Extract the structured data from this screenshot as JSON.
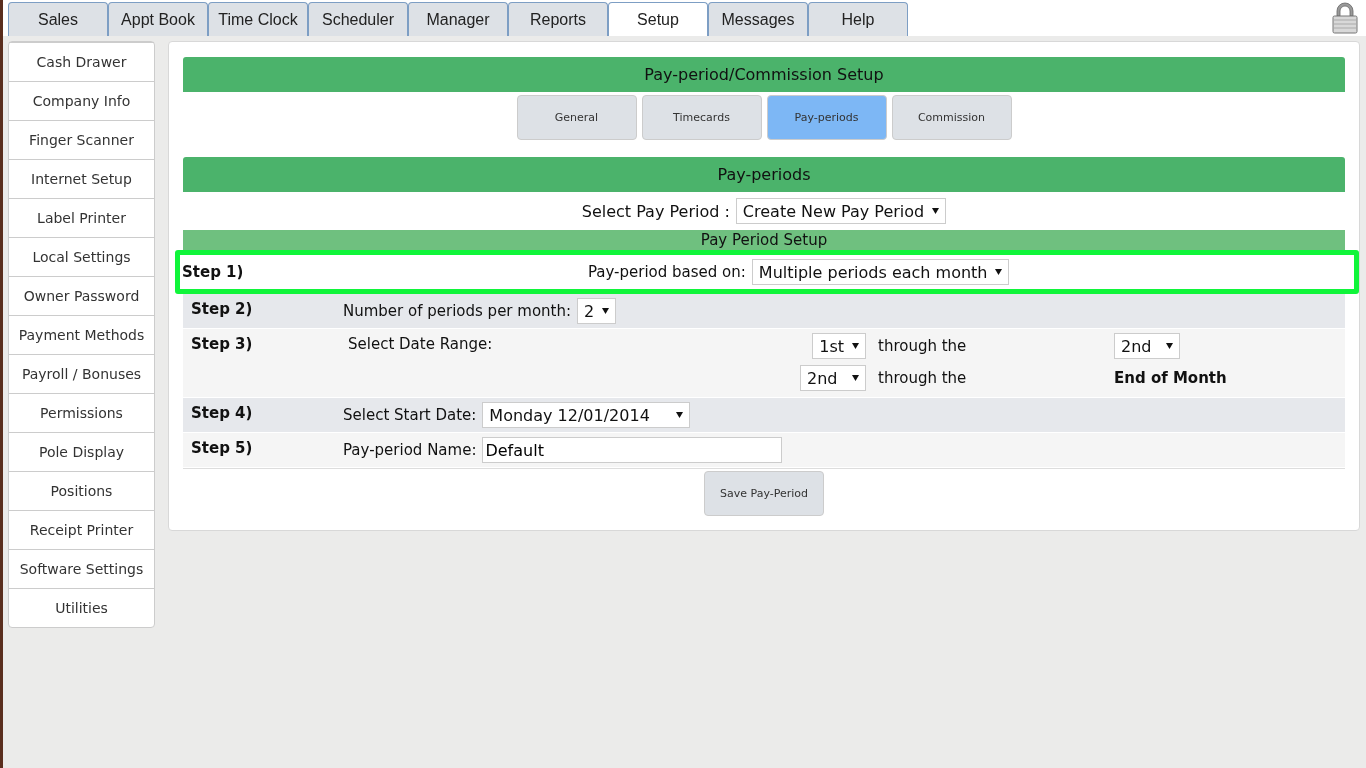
{
  "top_tabs": [
    {
      "label": "Sales",
      "selected": false
    },
    {
      "label": "Appt Book",
      "selected": false
    },
    {
      "label": "Time Clock",
      "selected": false
    },
    {
      "label": "Scheduler",
      "selected": false
    },
    {
      "label": "Manager",
      "selected": false
    },
    {
      "label": "Reports",
      "selected": false
    },
    {
      "label": "Setup",
      "selected": true
    },
    {
      "label": "Messages",
      "selected": false
    },
    {
      "label": "Help",
      "selected": false
    }
  ],
  "sidebar": {
    "items": [
      {
        "label": "Cash Drawer"
      },
      {
        "label": "Company Info"
      },
      {
        "label": "Finger Scanner"
      },
      {
        "label": "Internet Setup"
      },
      {
        "label": "Label Printer"
      },
      {
        "label": "Local Settings"
      },
      {
        "label": "Owner Password"
      },
      {
        "label": "Payment Methods"
      },
      {
        "label": "Payroll / Bonuses"
      },
      {
        "label": "Permissions"
      },
      {
        "label": "Pole Display"
      },
      {
        "label": "Positions"
      },
      {
        "label": "Receipt Printer"
      },
      {
        "label": "Software Settings"
      },
      {
        "label": "Utilities"
      }
    ]
  },
  "header": "Pay-period/Commission Setup",
  "sub_tabs": [
    {
      "label": "General",
      "selected": false
    },
    {
      "label": "Timecards",
      "selected": false
    },
    {
      "label": "Pay-periods",
      "selected": true
    },
    {
      "label": "Commission",
      "selected": false
    }
  ],
  "section_title": "Pay-periods",
  "select_pay_period": {
    "label": "Select Pay Period :",
    "value": "Create New Pay Period"
  },
  "setup_title": "Pay Period Setup",
  "steps": [
    {
      "step": "Step 1)",
      "highlighted": true,
      "kind": "select",
      "label": "Pay-period based on:",
      "value": "Multiple periods each month"
    },
    {
      "step": "Step 2)",
      "highlighted": false,
      "kind": "select",
      "label": "Number of periods per month:",
      "value": "2"
    },
    {
      "step": "Step 3)",
      "highlighted": false,
      "kind": "ranges",
      "label": "Select Date Range:",
      "ranges": [
        {
          "from": "1st",
          "through": "through the",
          "to": "2nd",
          "kind": "select"
        },
        {
          "from": "2nd",
          "through": "through the",
          "to": "End of Month",
          "kind": "text"
        }
      ]
    },
    {
      "step": "Step 4)",
      "highlighted": false,
      "kind": "select",
      "label": "Select Start Date:",
      "value": "Monday 12/01/2014"
    },
    {
      "step": "Step 5)",
      "highlighted": false,
      "kind": "input",
      "label": "Pay-period Name:",
      "value": "Default"
    }
  ],
  "save_button": "Save Pay-Period"
}
